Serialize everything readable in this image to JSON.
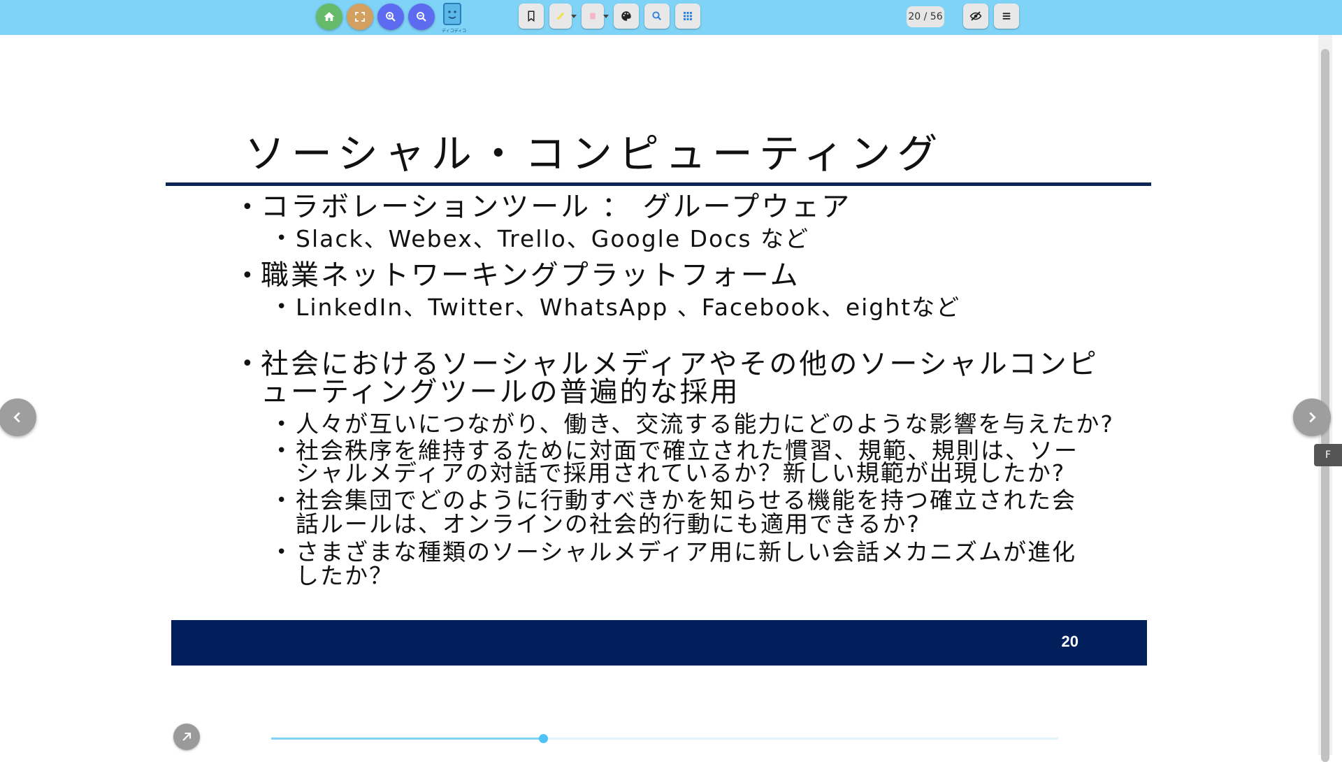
{
  "toolbar": {
    "page_counter": "20 / 56",
    "logo_text": "ディコディコ",
    "buttons": [
      {
        "icon": "home-icon",
        "color": "#66bb6a"
      },
      {
        "icon": "fullscreen-icon",
        "color": "#d4a060"
      },
      {
        "icon": "zoom-in-icon",
        "color": "#5c6bf0"
      },
      {
        "icon": "zoom-out-icon",
        "color": "#5c6bf0"
      },
      {
        "icon": "bookmark-icon"
      },
      {
        "icon": "highlighter-icon"
      },
      {
        "icon": "eraser-icon"
      },
      {
        "icon": "palette-icon"
      },
      {
        "icon": "search-icon"
      },
      {
        "icon": "grid-icon"
      },
      {
        "icon": "hide-icon"
      },
      {
        "icon": "menu-icon"
      }
    ]
  },
  "slide": {
    "title": "ソーシャル・コンピューティング",
    "bullets": [
      {
        "text": "コラボレーションツール ： グループウェア",
        "level": 1
      },
      {
        "text": "Slack、Webex、Trello、Google Docs など",
        "level": 2
      },
      {
        "text": "職業ネットワーキングプラットフォーム",
        "level": 1
      },
      {
        "text": "LinkedIn、Twitter、WhatsApp 、Facebook、eightなど",
        "level": 2
      },
      {
        "text": "社会におけるソーシャルメディアやその他のソーシャルコンピューティングツールの普遍的な採用",
        "level": 1
      },
      {
        "text": "人々が互いにつながり、働き、交流する能力にどのような影響を与えたか?",
        "level": 2
      },
      {
        "text": "社会秩序を維持するために対面で確立された慣習、規範、規則は、ソーシャルメディアの対話で採用されているか？新しい規範が出現したか?",
        "level": 2
      },
      {
        "text": "社会集団でどのように行動すべきかを知らせる機能を持つ確立された会話ルールは、オンラインの社会的行動にも適用できるか?",
        "level": 2
      },
      {
        "text": "さまざまな種類のソーシャルメディア用に新しい会話メカニズムが進化したか？",
        "level": 2
      }
    ],
    "footer_page_number": "20"
  },
  "side_tab_label": "F",
  "progress": {
    "current": 20,
    "total": 56
  },
  "colors": {
    "toolbar_bg": "#7fd3f7",
    "navy": "#001f5b",
    "accent": "#4fc3f7"
  }
}
